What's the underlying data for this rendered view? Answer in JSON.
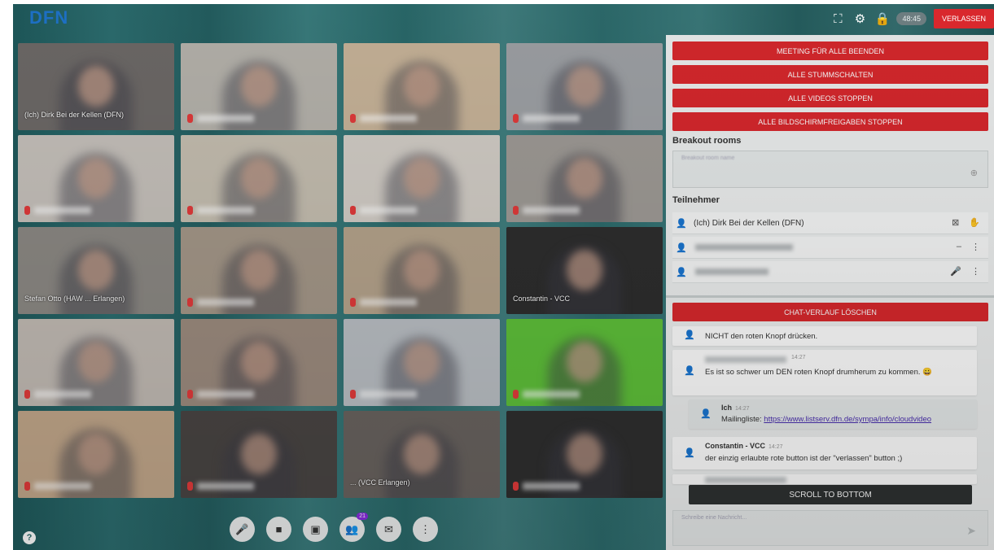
{
  "topbar": {
    "logo": "DFN",
    "timer": "48:45",
    "leave_label": "VERLASSEN",
    "icons": [
      "fullscreen-icon",
      "gear-icon",
      "lock-icon"
    ]
  },
  "grid": {
    "tiles": [
      {
        "name": "(Ich) Dirk Bei der Kellen (DFN)",
        "color": "#6e6a68"
      },
      {
        "name": "",
        "color": "#b7b4ad"
      },
      {
        "name": "",
        "color": "#c9b59a"
      },
      {
        "name": "",
        "color": "#9fa2a6"
      },
      {
        "name": "",
        "color": "#c8c3bd"
      },
      {
        "name": "",
        "color": "#c7c0b2"
      },
      {
        "name": "",
        "color": "#d4cfc8"
      },
      {
        "name": "",
        "color": "#a09c97"
      },
      {
        "name": "Stefan Otto (HAW ... Erlangen)",
        "color": "#8d8a85"
      },
      {
        "name": "",
        "color": "#a6998a"
      },
      {
        "name": "",
        "color": "#b7a58d"
      },
      {
        "name": "Constantin - VCC",
        "color": "#2e2e2e"
      },
      {
        "name": "",
        "color": "#c4bdb6"
      },
      {
        "name": "",
        "color": "#9e8d80"
      },
      {
        "name": "",
        "color": "#bcc1c6"
      },
      {
        "name": "",
        "color": "#5fc23a"
      },
      {
        "name": "",
        "color": "#c4a98c"
      },
      {
        "name": "",
        "color": "#4a4644"
      },
      {
        "name": "... (VCC Erlangen)",
        "color": "#6a6460"
      },
      {
        "name": "",
        "color": "#2f2f2f"
      }
    ]
  },
  "controls": {
    "buttons": [
      {
        "name": "microphone-button",
        "icon": "🎤"
      },
      {
        "name": "camera-button",
        "icon": "■"
      },
      {
        "name": "screenshare-button",
        "icon": "▣"
      },
      {
        "name": "participants-button",
        "icon": "👥",
        "badge": "21"
      },
      {
        "name": "chat-button",
        "icon": "✉"
      },
      {
        "name": "more-options-button",
        "icon": "⋮"
      }
    ],
    "help": "?"
  },
  "panel": {
    "admin_buttons": [
      "MEETING FÜR ALLE BEENDEN",
      "ALLE STUMMSCHALTEN",
      "ALLE VIDEOS STOPPEN",
      "ALLE BILDSCHIRMFREIGABEN STOPPEN"
    ],
    "breakout_title": "Breakout rooms",
    "breakout_placeholder": "Breakout room name",
    "participants_title": "Teilnehmer",
    "participants": [
      {
        "name": "(Ich) Dirk Bei der Kellen (DFN)"
      }
    ],
    "clear_chat_label": "CHAT-VERLAUF LÖSCHEN",
    "messages": [
      {
        "text": "NICHT den roten Knopf drücken."
      },
      {
        "time": "14:27",
        "text": "Es ist so schwer um DEN roten Knopf drumherum zu kommen. 😀"
      },
      {
        "author": "Ich",
        "time": "14:27",
        "text_prefix": "Mailingliste: ",
        "link": "https://www.listserv.dfn.de/sympa/info/cloudvideo"
      },
      {
        "author": "Constantin - VCC",
        "time": "14:27",
        "text": "der einzig erlaubte rote button ist der \"verlassen\" button ;)"
      }
    ],
    "scroll_label": "SCROLL TO BOTTOM",
    "input_placeholder": "Schreibe eine Nachricht..."
  }
}
